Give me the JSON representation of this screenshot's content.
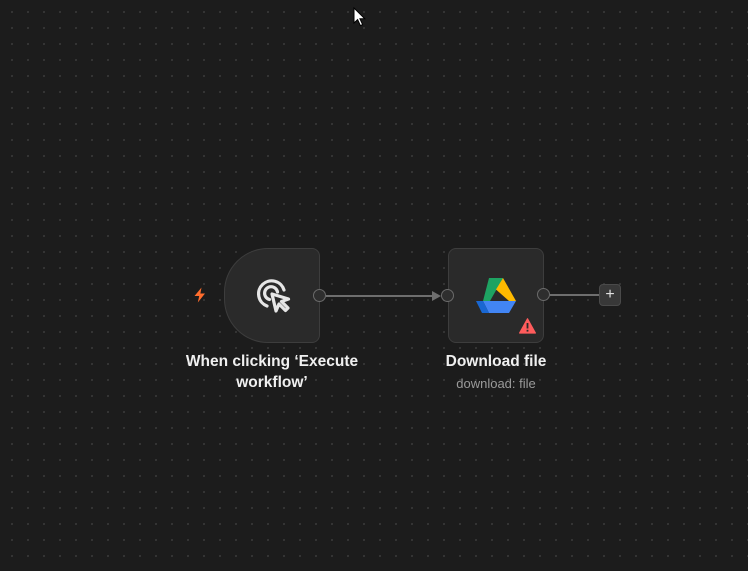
{
  "nodes": {
    "trigger": {
      "label": "When clicking ‘Execute workflow’",
      "icon": "pointer-click-icon"
    },
    "download": {
      "label": "Download file",
      "subtitle": "download: file",
      "icon": "google-drive-icon",
      "status_icon": "warning-icon"
    }
  },
  "add_button": {
    "label": "+"
  },
  "colors": {
    "canvas_bg": "#1c1c1c",
    "node_bg": "#2a2a2a",
    "trigger_bolt": "#ff6d2d",
    "warning": "#ff5c5c",
    "gdrive_green": "#1ea362",
    "gdrive_yellow": "#ffba00",
    "gdrive_blue": "#4285f4",
    "gdrive_darkblue": "#1967d2",
    "gdrive_red": "#ea4335"
  }
}
